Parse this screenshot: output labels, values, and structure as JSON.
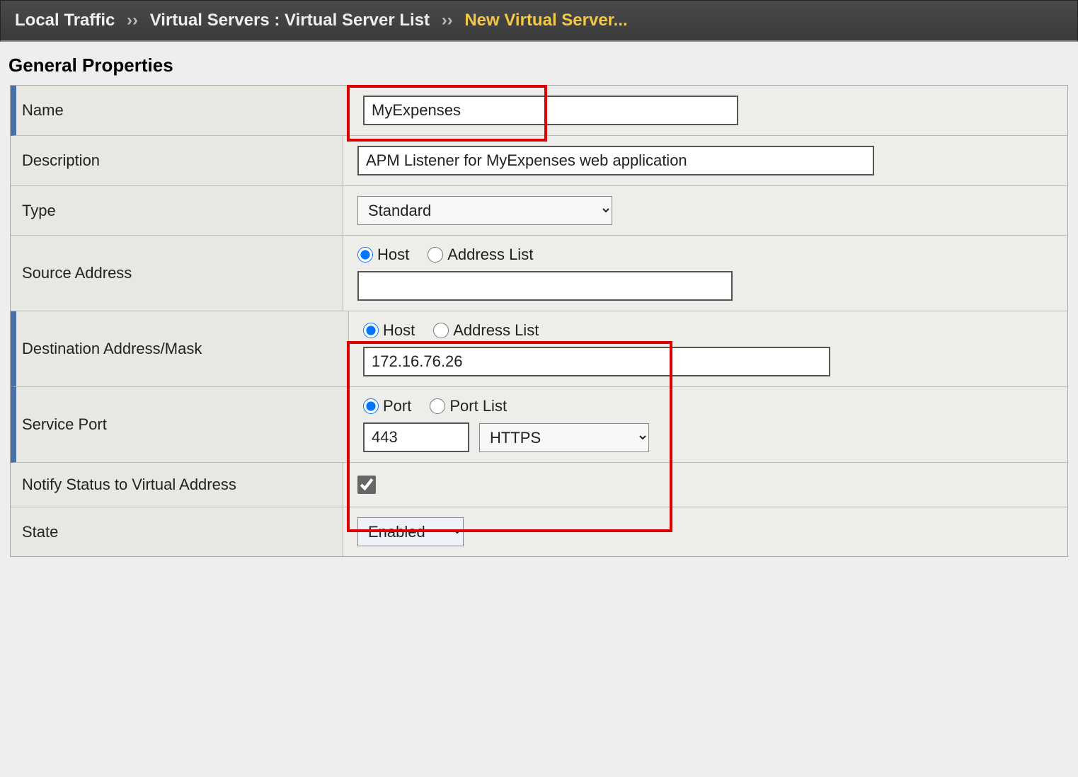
{
  "breadcrumb": {
    "seg1": "Local Traffic",
    "sep": "››",
    "seg2": "Virtual Servers : Virtual Server List",
    "seg3": "New Virtual Server..."
  },
  "section_title": "General Properties",
  "labels": {
    "name": "Name",
    "description": "Description",
    "type": "Type",
    "source_address": "Source Address",
    "destination_address": "Destination Address/Mask",
    "service_port": "Service Port",
    "notify_status": "Notify Status to Virtual Address",
    "state": "State"
  },
  "values": {
    "name": "MyExpenses",
    "description": "APM Listener for MyExpenses web application",
    "type_selected": "Standard",
    "source_address_value": "",
    "destination_address_value": "172.16.76.26",
    "port_value": "443",
    "port_service_selected": "HTTPS",
    "notify_status_checked": true,
    "state_selected": "Enabled"
  },
  "radios": {
    "host": "Host",
    "address_list": "Address List",
    "port": "Port",
    "port_list": "Port List"
  }
}
